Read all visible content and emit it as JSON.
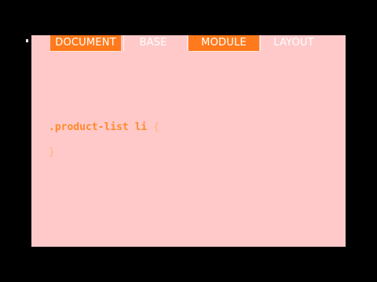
{
  "tabs": [
    {
      "label": "DOCUMENT",
      "active": true
    },
    {
      "label": "BASE",
      "active": false
    },
    {
      "label": "MODULE",
      "active": true
    },
    {
      "label": "LAYOUT",
      "active": false
    }
  ],
  "code": {
    "selector": ".product-list li",
    "open_brace": "{",
    "close_brace": "}"
  },
  "colors": {
    "background": "#000000",
    "slide": "#ffc9c9",
    "accent": "#ff7a1c"
  }
}
